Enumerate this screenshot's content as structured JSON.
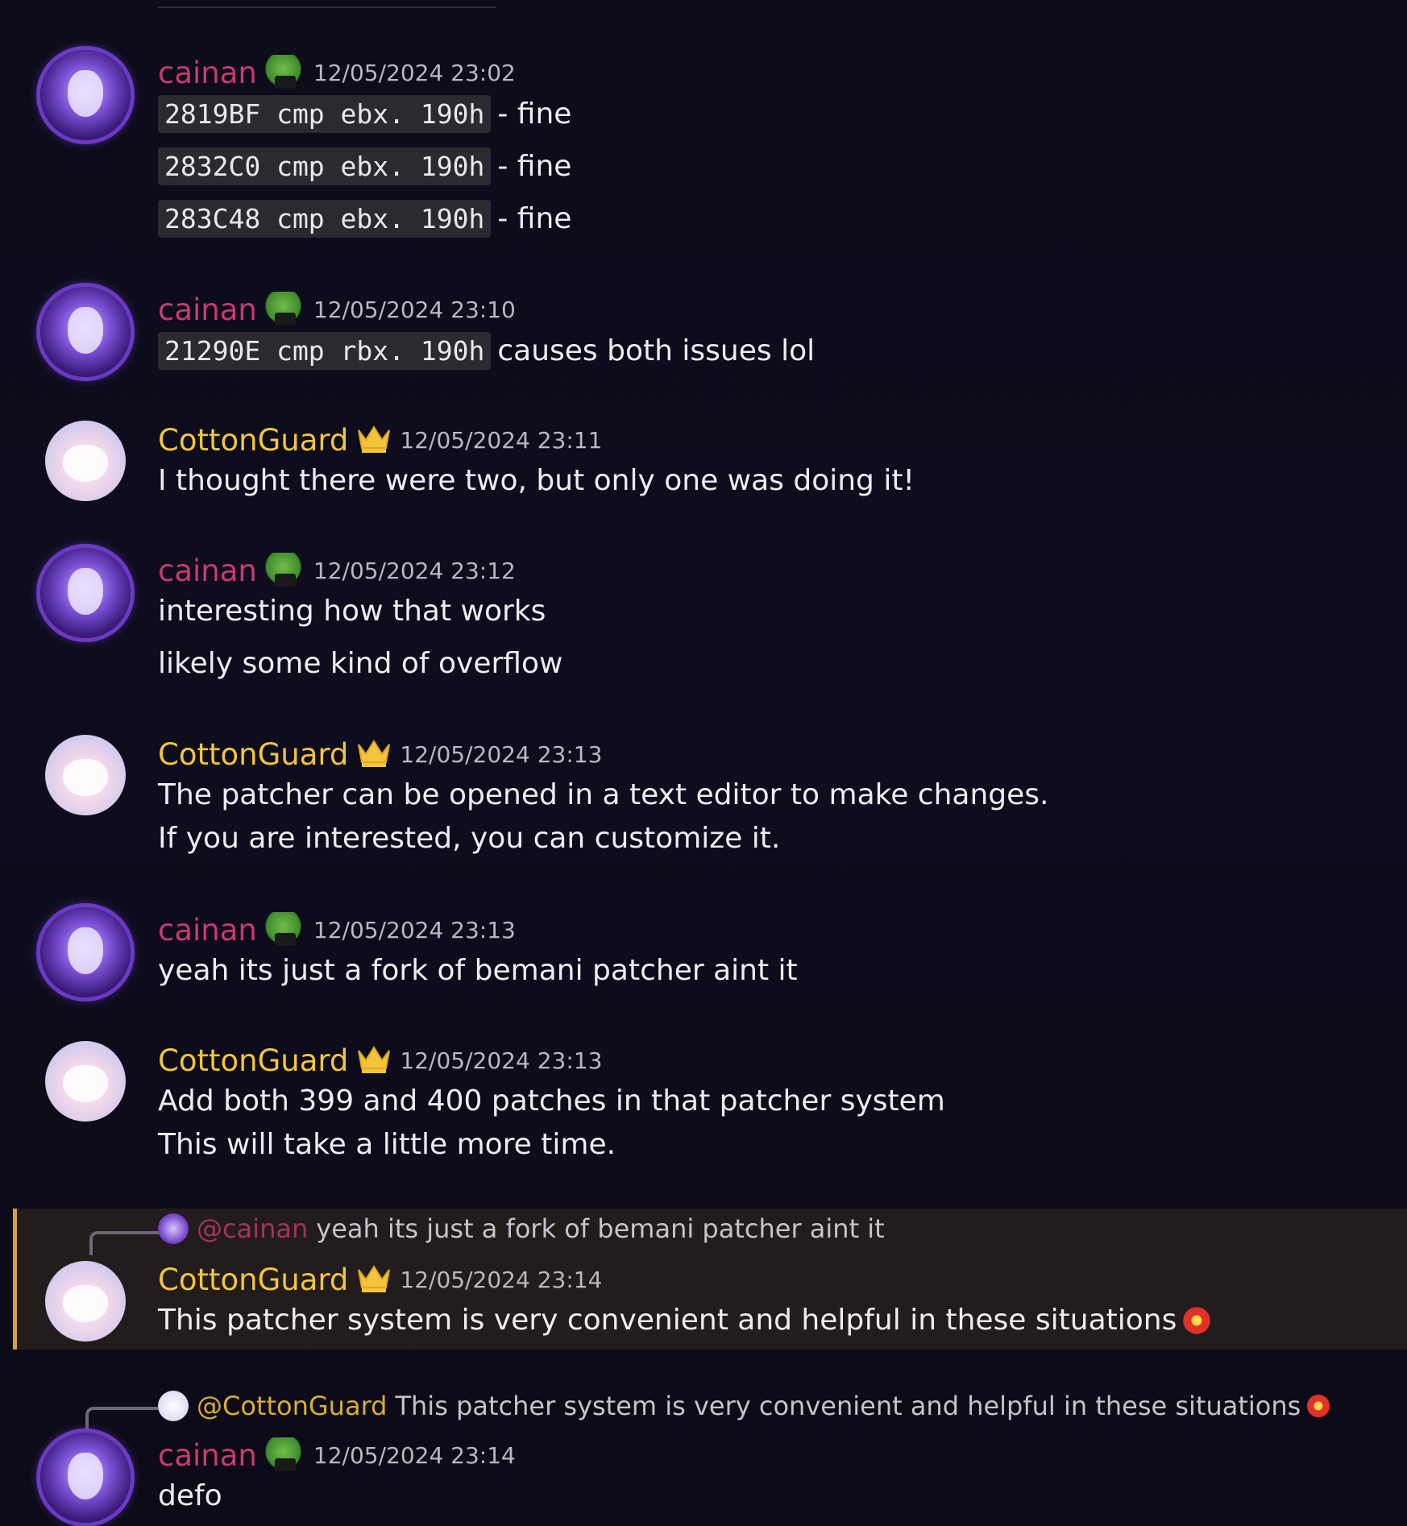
{
  "messages": [
    {
      "author": "cainan",
      "timestamp": "12/05/2024 23:02",
      "lines": [
        {
          "code": "2819BF cmp ebx. 190h",
          "text": "- fine"
        },
        {
          "code": "2832C0 cmp ebx. 190h",
          "text": "- fine"
        },
        {
          "code": "283C48 cmp ebx. 190h",
          "text": "- fine"
        }
      ]
    },
    {
      "author": "cainan",
      "timestamp": "12/05/2024 23:10",
      "lines": [
        {
          "code": "21290E cmp rbx. 190h",
          "text": "causes both issues lol"
        }
      ]
    },
    {
      "author": "CottonGuard",
      "timestamp": "12/05/2024 23:11",
      "lines": [
        {
          "text": "I thought there were two, but only one was doing it!"
        }
      ]
    },
    {
      "author": "cainan",
      "timestamp": "12/05/2024 23:12",
      "lines": [
        {
          "text": "interesting how that works"
        },
        {
          "text": "likely some kind of overflow"
        }
      ]
    },
    {
      "author": "CottonGuard",
      "timestamp": "12/05/2024 23:13",
      "lines": [
        {
          "text": "The patcher can be opened in a text editor to make changes."
        },
        {
          "text": "If you are interested, you can customize it."
        }
      ]
    },
    {
      "author": "cainan",
      "timestamp": "12/05/2024 23:13",
      "lines": [
        {
          "text": "yeah its just a fork of bemani patcher aint it"
        }
      ]
    },
    {
      "author": "CottonGuard",
      "timestamp": "12/05/2024 23:13",
      "lines": [
        {
          "text": "Add both 399 and 400 patches in that patcher system"
        },
        {
          "text": "This will take a little more time."
        }
      ]
    },
    {
      "author": "CottonGuard",
      "timestamp": "12/05/2024 23:14",
      "reply": {
        "mention": "@cainan",
        "text": "yeah its just a fork of bemani patcher aint it"
      },
      "lines": [
        {
          "text": "This patcher system is very convenient and helpful in these situations"
        }
      ]
    },
    {
      "author": "cainan",
      "timestamp": "12/05/2024 23:14",
      "reply": {
        "mention": "@CottonGuard",
        "text": "This patcher system is very convenient and helpful in these situations"
      },
      "lines": [
        {
          "text": "defo"
        }
      ]
    }
  ],
  "icons": {
    "cainan_badge": "frog-emoji-icon",
    "cotton_badge": "crown-icon",
    "flower": "red-flower-emoji-icon"
  },
  "colors": {
    "cainan": "#c93a70",
    "cotton": "#f3c53a",
    "highlight_border": "#d4a23c"
  }
}
